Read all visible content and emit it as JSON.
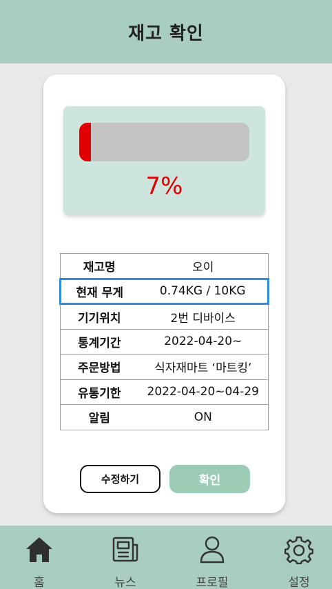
{
  "header": {
    "title": "재고 확인"
  },
  "stock_gauge": {
    "percent_label": "7%",
    "level": 0.07
  },
  "info_rows": [
    {
      "label": "재고명",
      "value": "오이"
    },
    {
      "label": "현재 무게",
      "value": "0.74KG / 10KG"
    },
    {
      "label": "기기위치",
      "value": "2번 디바이스"
    },
    {
      "label": "통계기간",
      "value": "2022-04-20~"
    },
    {
      "label": "주문방법",
      "value": "식자재마트 ‘마트킹’"
    },
    {
      "label": "유통기한",
      "value": "2022-04-20~04-29"
    },
    {
      "label": "알림",
      "value": "ON"
    }
  ],
  "actions": {
    "edit_label": "수정하기",
    "confirm_label": "확인"
  },
  "bottom_nav": [
    {
      "label": "홈",
      "icon": "home-icon"
    },
    {
      "label": "뉴스",
      "icon": "news-icon"
    },
    {
      "label": "프로필",
      "icon": "profile-icon"
    },
    {
      "label": "설정",
      "icon": "gear-icon"
    }
  ],
  "colors": {
    "header_bg": "#a9cdbf",
    "gauge_box_bg": "#cde5dc",
    "gauge_fill": "#e00000",
    "highlight_border": "#2d8ee0",
    "confirm_button": "#9ccbb6"
  }
}
